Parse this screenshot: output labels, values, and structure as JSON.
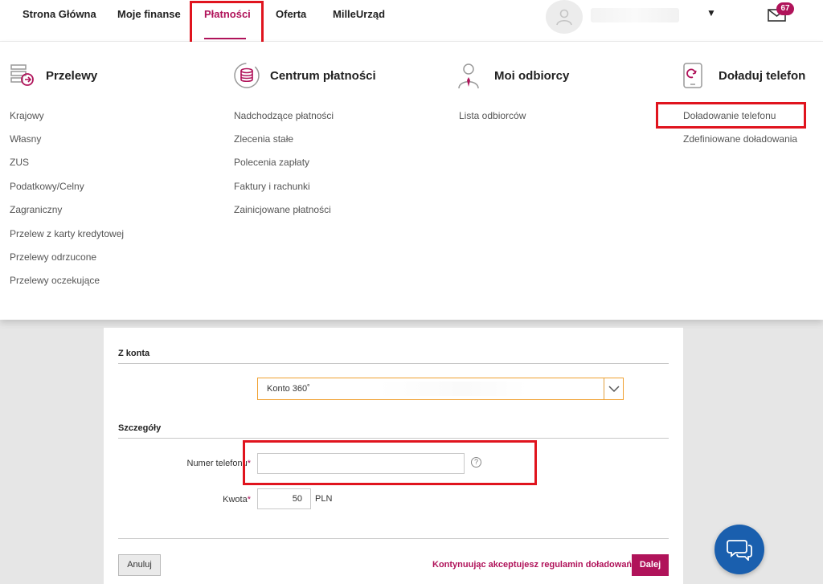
{
  "nav": {
    "items": [
      "Strona Główna",
      "Moje finanse",
      "Płatności",
      "Oferta",
      "MilleUrząd"
    ],
    "active": "Płatności",
    "messages_count": "67"
  },
  "menu": {
    "columns": [
      {
        "title": "Przelewy",
        "icon": "transfer-icon",
        "links": [
          "Krajowy",
          "Własny",
          "ZUS",
          "Podatkowy/Celny",
          "Zagraniczny",
          "Przelew z karty kredytowej",
          "Przelewy odrzucone",
          "Przelewy oczekujące"
        ]
      },
      {
        "title": "Centrum płatności",
        "icon": "coins-icon",
        "links": [
          "Nadchodzące płatności",
          "Zlecenia stałe",
          "Polecenia zapłaty",
          "Faktury i rachunki",
          "Zainicjowane płatności"
        ]
      },
      {
        "title": "Moi odbiorcy",
        "icon": "person-icon",
        "links": [
          "Lista odbiorców"
        ]
      },
      {
        "title": "Doładuj telefon",
        "icon": "phone-topup-icon",
        "links": [
          "Doładowanie telefonu",
          "Zdefiniowane doładowania"
        ]
      }
    ]
  },
  "form": {
    "from_account_title": "Z konta",
    "account_value": "Konto 360˚",
    "details_title": "Szczegóły",
    "phone_label": "Numer telefonu",
    "phone_value": "",
    "amount_label": "Kwota",
    "amount_value": "50",
    "currency": "PLN",
    "required_mark": "*",
    "help_glyph": "?",
    "cancel_label": "Anuluj",
    "terms_text": "Kontynuując akceptujesz regulamin doładowań.",
    "next_label": "Dalej"
  },
  "colors": {
    "accent": "#b0135a",
    "highlight": "#e0141e",
    "select_border": "#f0a030",
    "chat": "#1a5fae"
  }
}
